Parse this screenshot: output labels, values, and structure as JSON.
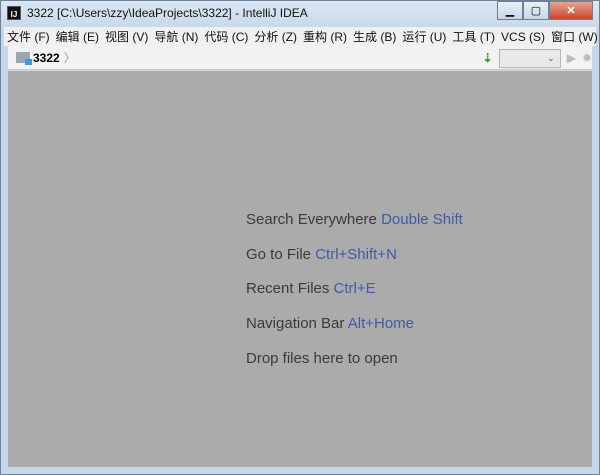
{
  "window": {
    "title": "3322 [C:\\Users\\zzy\\IdeaProjects\\3322] - IntelliJ IDEA",
    "icon": "IJ"
  },
  "menu": [
    "文件 (F)",
    "编辑 (E)",
    "视图 (V)",
    "导航 (N)",
    "代码 (C)",
    "分析 (Z)",
    "重构 (R)",
    "生成 (B)",
    "运行 (U)",
    "工具 (T)",
    "VCS (S)",
    "窗口 (W)"
  ],
  "toolbar": {
    "project": "3322"
  },
  "hints": [
    {
      "text": "Search Everywhere",
      "key": "Double Shift"
    },
    {
      "text": "Go to File",
      "key": "Ctrl+Shift+N"
    },
    {
      "text": "Recent Files",
      "key": "Ctrl+E"
    },
    {
      "text": "Navigation Bar",
      "key": "Alt+Home"
    },
    {
      "text": "Drop files here to open",
      "key": ""
    }
  ]
}
